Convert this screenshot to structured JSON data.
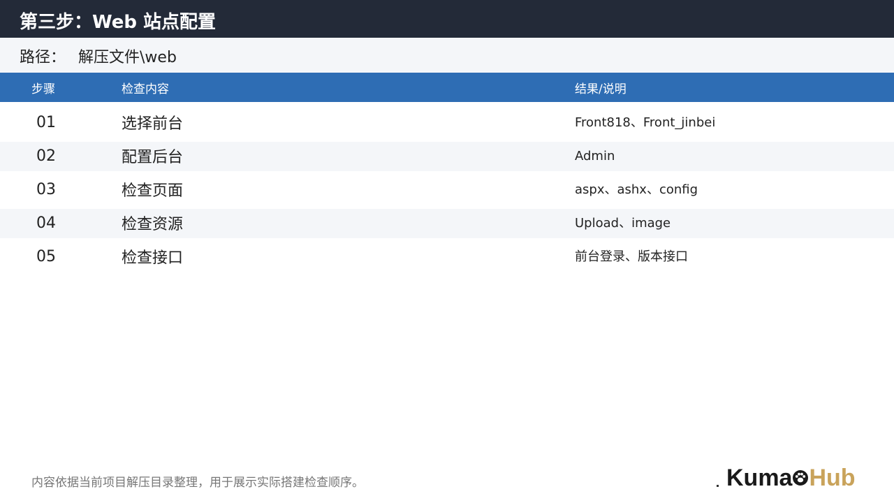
{
  "header": {
    "title": "第三步：Web 站点配置"
  },
  "path": {
    "label": "路径：",
    "value": "解压文件\\web"
  },
  "table": {
    "columns": [
      "步骤",
      "检查内容",
      "结果/说明"
    ],
    "rows": [
      {
        "step": "01",
        "item": "选择前台",
        "result": "Front818、Front_jinbei"
      },
      {
        "step": "02",
        "item": "配置后台",
        "result": "Admin"
      },
      {
        "step": "03",
        "item": "检查页面",
        "result": "aspx、ashx、config"
      },
      {
        "step": "04",
        "item": "检查资源",
        "result": "Upload、image"
      },
      {
        "step": "05",
        "item": "检查接口",
        "result": "前台登录、版本接口"
      }
    ]
  },
  "footer": {
    "note": "内容依据当前项目解压目录整理，用于展示实际搭建检查顺序。",
    "logo_part1": "Kuma",
    "logo_part2": "Hub",
    "logo_icon": "paw-icon"
  },
  "colors": {
    "title_bg": "#232a38",
    "header_bg": "#2e6db4",
    "band_bg": "#f4f6f9",
    "logo_gold": "#c9a35b"
  }
}
